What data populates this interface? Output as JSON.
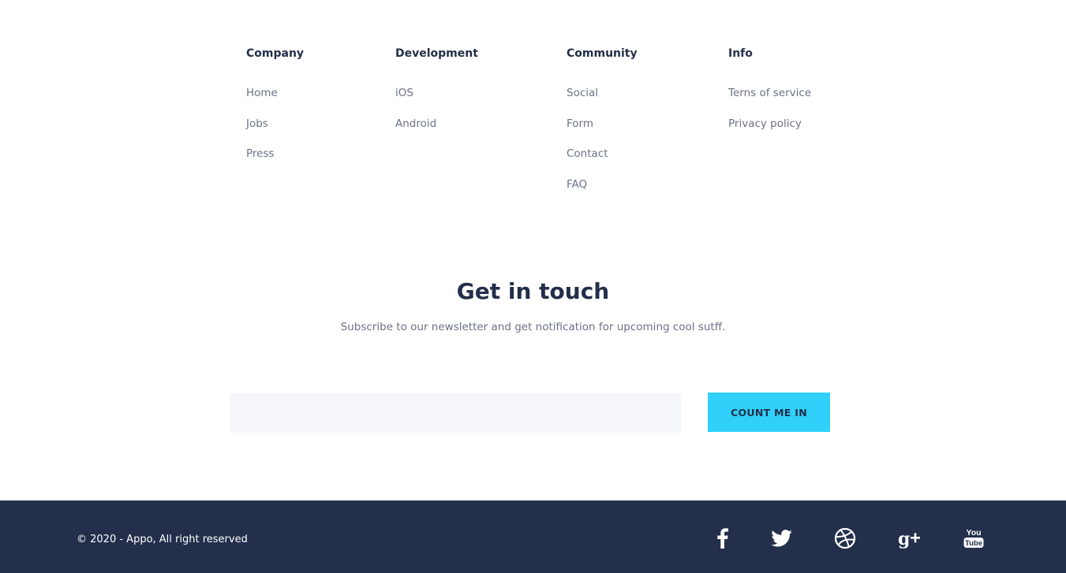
{
  "columns": [
    {
      "title": "Company",
      "items": [
        "Home",
        "Jobs",
        "Press"
      ]
    },
    {
      "title": "Development",
      "items": [
        "iOS",
        "Android"
      ]
    },
    {
      "title": "Community",
      "items": [
        "Social",
        "Form",
        "Contact",
        "FAQ"
      ]
    },
    {
      "title": "Info",
      "items": [
        "Terns of service",
        "Privacy policy"
      ]
    }
  ],
  "newsletter": {
    "title": "Get in touch",
    "subtitle": "Subscribe to our newsletter and get notification for upcoming cool sutff.",
    "input_value": "",
    "input_placeholder": "",
    "button_label": "COUNT ME IN"
  },
  "footer": {
    "copyright": "© 2020 - Appo, All right reserved",
    "social": [
      "facebook-icon",
      "twitter-icon",
      "dribbble-icon",
      "google-plus-icon",
      "youtube-icon"
    ],
    "background_color": "#232f4b"
  },
  "colors": {
    "heading": "#232f49",
    "text_muted": "#6a7285",
    "accent": "#2fd0fa",
    "input_bg": "#f4f6f9"
  }
}
